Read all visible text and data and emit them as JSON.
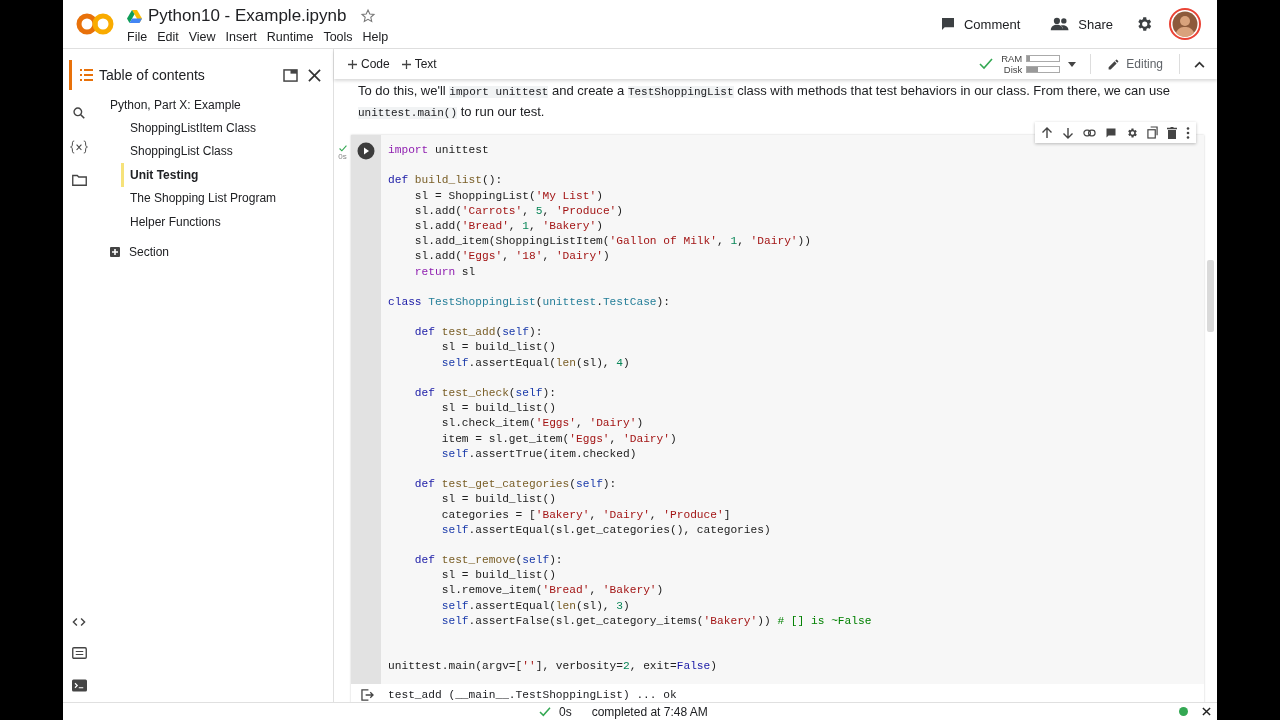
{
  "header": {
    "title": "Python10 - Example.ipynb",
    "menu": [
      "File",
      "Edit",
      "View",
      "Insert",
      "Runtime",
      "Tools",
      "Help"
    ],
    "actions": [
      {
        "kind": "comment",
        "label": "Comment"
      },
      {
        "kind": "share",
        "label": "Share"
      }
    ]
  },
  "toolbar": {
    "add_buttons": [
      "Code",
      "Text"
    ],
    "resources": [
      {
        "label": "RAM",
        "level": 0.08
      },
      {
        "label": "Disk",
        "level": 0.35
      }
    ],
    "mode": "Editing"
  },
  "toc": {
    "title": "Table of contents",
    "items": [
      {
        "label": "Python, Part X: Example",
        "selected": false,
        "children": [
          {
            "label": "ShoppingListItem Class",
            "selected": false
          },
          {
            "label": "ShoppingList Class",
            "selected": false
          },
          {
            "label": "Unit Testing",
            "selected": true
          },
          {
            "label": "The Shopping List Program",
            "selected": false
          },
          {
            "label": "Helper Functions",
            "selected": false
          }
        ]
      }
    ],
    "add_section": "Section"
  },
  "text_cell": {
    "segments": [
      {
        "kind": "text",
        "text": "To do this, we'll "
      },
      {
        "kind": "code",
        "text": "import unittest"
      },
      {
        "kind": "text",
        "text": " and create a "
      },
      {
        "kind": "code",
        "text": "TestShoppingList"
      },
      {
        "kind": "text",
        "text": " class with methods that test behaviors in our class. From there, we can use "
      },
      {
        "kind": "code",
        "text": "unittest.main()"
      },
      {
        "kind": "text",
        "text": " to run our test."
      }
    ]
  },
  "code_cell": {
    "run_time": "0s",
    "lines": [
      {
        "kind": "code",
        "tokens": [
          {
            "kind": "ctrl",
            "text": "import"
          },
          {
            "kind": "plain",
            "text": " unittest"
          }
        ]
      },
      {
        "kind": "blank"
      },
      {
        "kind": "code",
        "tokens": [
          {
            "kind": "kw",
            "text": "def "
          },
          {
            "kind": "fn",
            "text": "build_list"
          },
          {
            "kind": "plain",
            "text": "():"
          }
        ]
      },
      {
        "kind": "code",
        "tokens": [
          {
            "kind": "plain",
            "text": "    sl = ShoppingList("
          },
          {
            "kind": "str",
            "text": "'My List'"
          },
          {
            "kind": "plain",
            "text": ")"
          }
        ]
      },
      {
        "kind": "code",
        "tokens": [
          {
            "kind": "plain",
            "text": "    sl.add("
          },
          {
            "kind": "str",
            "text": "'Carrots'"
          },
          {
            "kind": "plain",
            "text": ", "
          },
          {
            "kind": "num",
            "text": "5"
          },
          {
            "kind": "plain",
            "text": ", "
          },
          {
            "kind": "str",
            "text": "'Produce'"
          },
          {
            "kind": "plain",
            "text": ")"
          }
        ]
      },
      {
        "kind": "code",
        "tokens": [
          {
            "kind": "plain",
            "text": "    sl.add("
          },
          {
            "kind": "str",
            "text": "'Bread'"
          },
          {
            "kind": "plain",
            "text": ", "
          },
          {
            "kind": "num",
            "text": "1"
          },
          {
            "kind": "plain",
            "text": ", "
          },
          {
            "kind": "str",
            "text": "'Bakery'"
          },
          {
            "kind": "plain",
            "text": ")"
          }
        ]
      },
      {
        "kind": "code",
        "tokens": [
          {
            "kind": "plain",
            "text": "    sl.add_item(ShoppingListItem("
          },
          {
            "kind": "str",
            "text": "'Gallon of Milk'"
          },
          {
            "kind": "plain",
            "text": ", "
          },
          {
            "kind": "num",
            "text": "1"
          },
          {
            "kind": "plain",
            "text": ", "
          },
          {
            "kind": "str",
            "text": "'Dairy'"
          },
          {
            "kind": "plain",
            "text": "))"
          }
        ]
      },
      {
        "kind": "code",
        "tokens": [
          {
            "kind": "plain",
            "text": "    sl.add("
          },
          {
            "kind": "str",
            "text": "'Eggs'"
          },
          {
            "kind": "plain",
            "text": ", "
          },
          {
            "kind": "str",
            "text": "'18'"
          },
          {
            "kind": "plain",
            "text": ", "
          },
          {
            "kind": "str",
            "text": "'Dairy'"
          },
          {
            "kind": "plain",
            "text": ")"
          }
        ]
      },
      {
        "kind": "code",
        "tokens": [
          {
            "kind": "ctrl",
            "text": "    return"
          },
          {
            "kind": "plain",
            "text": " sl"
          }
        ]
      },
      {
        "kind": "blank"
      },
      {
        "kind": "code",
        "tokens": [
          {
            "kind": "kw",
            "text": "class "
          },
          {
            "kind": "cls",
            "text": "TestShoppingList"
          },
          {
            "kind": "plain",
            "text": "("
          },
          {
            "kind": "cls",
            "text": "unittest"
          },
          {
            "kind": "plain",
            "text": "."
          },
          {
            "kind": "cls",
            "text": "TestCase"
          },
          {
            "kind": "plain",
            "text": "):"
          }
        ]
      },
      {
        "kind": "blank"
      },
      {
        "kind": "code",
        "tokens": [
          {
            "kind": "kw",
            "text": "    def "
          },
          {
            "kind": "fn",
            "text": "test_add"
          },
          {
            "kind": "plain",
            "text": "("
          },
          {
            "kind": "self",
            "text": "self"
          },
          {
            "kind": "plain",
            "text": "):"
          }
        ]
      },
      {
        "kind": "code",
        "tokens": [
          {
            "kind": "plain",
            "text": "        sl = build_list()"
          }
        ]
      },
      {
        "kind": "code",
        "tokens": [
          {
            "kind": "self",
            "text": "        self"
          },
          {
            "kind": "plain",
            "text": ".assertEqual("
          },
          {
            "kind": "fn",
            "text": "len"
          },
          {
            "kind": "plain",
            "text": "(sl), "
          },
          {
            "kind": "num",
            "text": "4"
          },
          {
            "kind": "plain",
            "text": ")"
          }
        ]
      },
      {
        "kind": "blank"
      },
      {
        "kind": "code",
        "tokens": [
          {
            "kind": "kw",
            "text": "    def "
          },
          {
            "kind": "fn",
            "text": "test_check"
          },
          {
            "kind": "plain",
            "text": "("
          },
          {
            "kind": "self",
            "text": "self"
          },
          {
            "kind": "plain",
            "text": "):"
          }
        ]
      },
      {
        "kind": "code",
        "tokens": [
          {
            "kind": "plain",
            "text": "        sl = build_list()"
          }
        ]
      },
      {
        "kind": "code",
        "tokens": [
          {
            "kind": "plain",
            "text": "        sl.check_item("
          },
          {
            "kind": "str",
            "text": "'Eggs'"
          },
          {
            "kind": "plain",
            "text": ", "
          },
          {
            "kind": "str",
            "text": "'Dairy'"
          },
          {
            "kind": "plain",
            "text": ")"
          }
        ]
      },
      {
        "kind": "code",
        "tokens": [
          {
            "kind": "plain",
            "text": "        item = sl.get_item("
          },
          {
            "kind": "str",
            "text": "'Eggs'"
          },
          {
            "kind": "plain",
            "text": ", "
          },
          {
            "kind": "str",
            "text": "'Dairy'"
          },
          {
            "kind": "plain",
            "text": ")"
          }
        ]
      },
      {
        "kind": "code",
        "tokens": [
          {
            "kind": "self",
            "text": "        self"
          },
          {
            "kind": "plain",
            "text": ".assertTrue(item.checked)"
          }
        ]
      },
      {
        "kind": "blank"
      },
      {
        "kind": "code",
        "tokens": [
          {
            "kind": "kw",
            "text": "    def "
          },
          {
            "kind": "fn",
            "text": "test_get_categories"
          },
          {
            "kind": "plain",
            "text": "("
          },
          {
            "kind": "self",
            "text": "self"
          },
          {
            "kind": "plain",
            "text": "):"
          }
        ]
      },
      {
        "kind": "code",
        "tokens": [
          {
            "kind": "plain",
            "text": "        sl = build_list()"
          }
        ]
      },
      {
        "kind": "code",
        "tokens": [
          {
            "kind": "plain",
            "text": "        categories = ["
          },
          {
            "kind": "str",
            "text": "'Bakery'"
          },
          {
            "kind": "plain",
            "text": ", "
          },
          {
            "kind": "str",
            "text": "'Dairy'"
          },
          {
            "kind": "plain",
            "text": ", "
          },
          {
            "kind": "str",
            "text": "'Produce'"
          },
          {
            "kind": "plain",
            "text": "]"
          }
        ]
      },
      {
        "kind": "code",
        "tokens": [
          {
            "kind": "self",
            "text": "        self"
          },
          {
            "kind": "plain",
            "text": ".assertEqual(sl.get_categories(), categories)"
          }
        ]
      },
      {
        "kind": "blank"
      },
      {
        "kind": "code",
        "tokens": [
          {
            "kind": "kw",
            "text": "    def "
          },
          {
            "kind": "fn",
            "text": "test_remove"
          },
          {
            "kind": "plain",
            "text": "("
          },
          {
            "kind": "self",
            "text": "self"
          },
          {
            "kind": "plain",
            "text": "):"
          }
        ]
      },
      {
        "kind": "code",
        "tokens": [
          {
            "kind": "plain",
            "text": "        sl = build_list()"
          }
        ]
      },
      {
        "kind": "code",
        "tokens": [
          {
            "kind": "plain",
            "text": "        sl.remove_item("
          },
          {
            "kind": "str",
            "text": "'Bread'"
          },
          {
            "kind": "plain",
            "text": ", "
          },
          {
            "kind": "str",
            "text": "'Bakery'"
          },
          {
            "kind": "plain",
            "text": ")"
          }
        ]
      },
      {
        "kind": "code",
        "tokens": [
          {
            "kind": "self",
            "text": "        self"
          },
          {
            "kind": "plain",
            "text": ".assertEqual("
          },
          {
            "kind": "fn",
            "text": "len"
          },
          {
            "kind": "plain",
            "text": "(sl), "
          },
          {
            "kind": "num",
            "text": "3"
          },
          {
            "kind": "plain",
            "text": ")"
          }
        ]
      },
      {
        "kind": "code",
        "tokens": [
          {
            "kind": "self",
            "text": "        self"
          },
          {
            "kind": "plain",
            "text": ".assertFalse(sl.get_category_items("
          },
          {
            "kind": "str",
            "text": "'Bakery'"
          },
          {
            "kind": "plain",
            "text": ")) "
          },
          {
            "kind": "comment",
            "text": "# [] is ~False"
          }
        ]
      },
      {
        "kind": "blank"
      },
      {
        "kind": "blank"
      },
      {
        "kind": "code",
        "tokens": [
          {
            "kind": "plain",
            "text": "unittest.main(argv=["
          },
          {
            "kind": "str",
            "text": "''"
          },
          {
            "kind": "plain",
            "text": "], verbosity="
          },
          {
            "kind": "num",
            "text": "2"
          },
          {
            "kind": "plain",
            "text": ", exit="
          },
          {
            "kind": "const",
            "text": "False"
          },
          {
            "kind": "plain",
            "text": ")"
          }
        ]
      }
    ],
    "output": "test_add (__main__.TestShoppingList) ... ok"
  },
  "status_bar": {
    "elapsed": "0s",
    "message": "completed at 7:48 AM",
    "connected": true
  }
}
